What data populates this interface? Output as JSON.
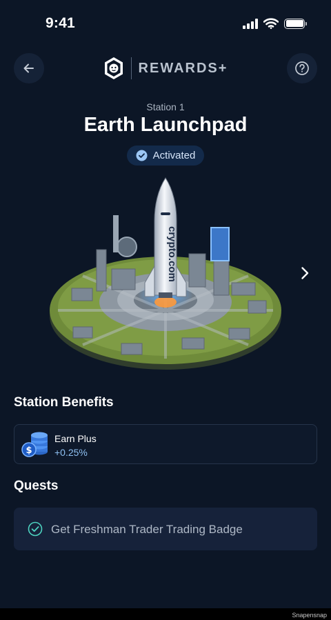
{
  "status_bar": {
    "time": "9:41",
    "icons": [
      "cellular-signal-icon",
      "wifi-icon",
      "battery-icon"
    ]
  },
  "header": {
    "back_icon": "arrow-left-icon",
    "logo_icon": "crypto-com-lion-shield-icon",
    "brand_text": "REWARDS+",
    "help_icon": "question-mark-icon"
  },
  "station": {
    "number_label": "Station 1",
    "name": "Earth Launchpad",
    "status_label": "Activated",
    "status_icon": "check-circle-icon",
    "image": "rocket-launchpad-illustration",
    "rocket_brand_text": "crypto.com",
    "next_icon": "chevron-right-icon"
  },
  "benefits": {
    "title": "Station Benefits",
    "items": [
      {
        "icon": "coin-stack-icon",
        "name": "Earn Plus",
        "value": "+0.25%"
      }
    ]
  },
  "quests": {
    "title": "Quests",
    "items": [
      {
        "icon": "check-circle-outline-icon",
        "label": "Get Freshman Trader Trading Badge"
      }
    ]
  },
  "footer": {
    "watermark": "Snapensnap"
  },
  "colors": {
    "background": "#0c1626",
    "card_border": "#26344a",
    "quest_card": "#16223a",
    "accent_blue": "#8ec0f2",
    "check_teal": "#4dd3c0",
    "pill_bg": "#132a4a"
  }
}
